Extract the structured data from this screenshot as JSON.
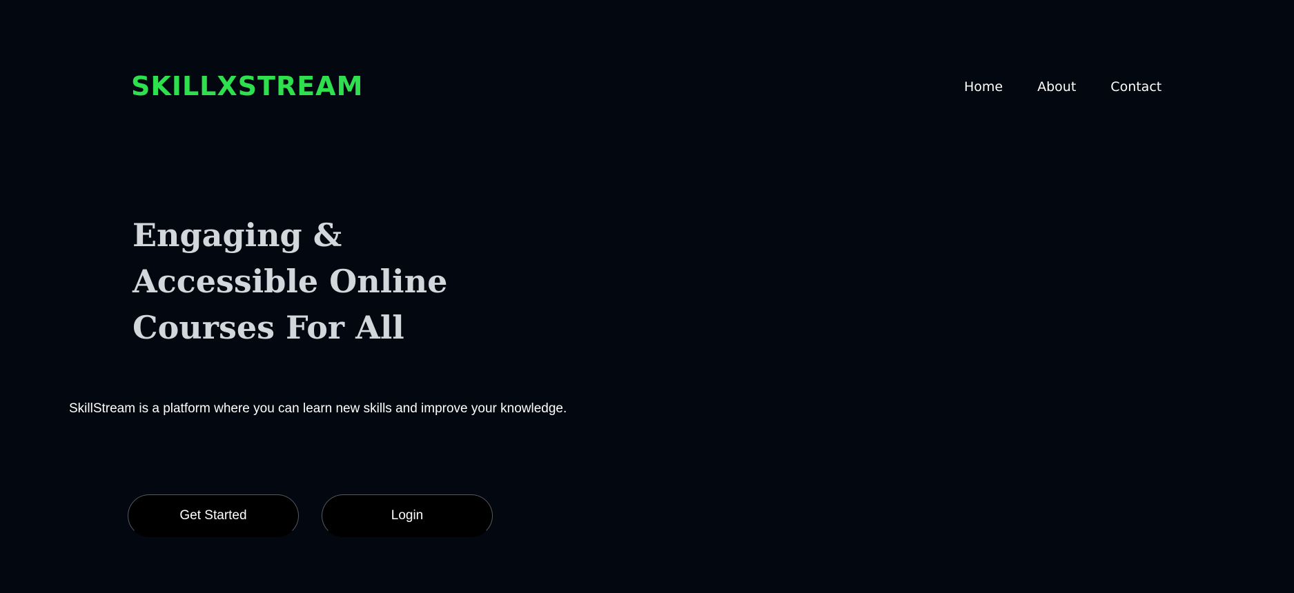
{
  "header": {
    "brand": "SKILLXSTREAM",
    "nav": {
      "home": "Home",
      "about": "About",
      "contact": "Contact"
    }
  },
  "hero": {
    "headline_lines": [
      "Engaging &",
      "Accessible Online",
      "Courses For All"
    ],
    "tagline": "SkillStream is a platform where you can learn new skills and improve your knowledge.",
    "buttons": {
      "get_started": "Get Started",
      "login": "Login"
    }
  },
  "colors": {
    "background": "#030810",
    "brand": "#2ee04e",
    "headline": "#d3d7dc",
    "button_background": "#000000"
  }
}
